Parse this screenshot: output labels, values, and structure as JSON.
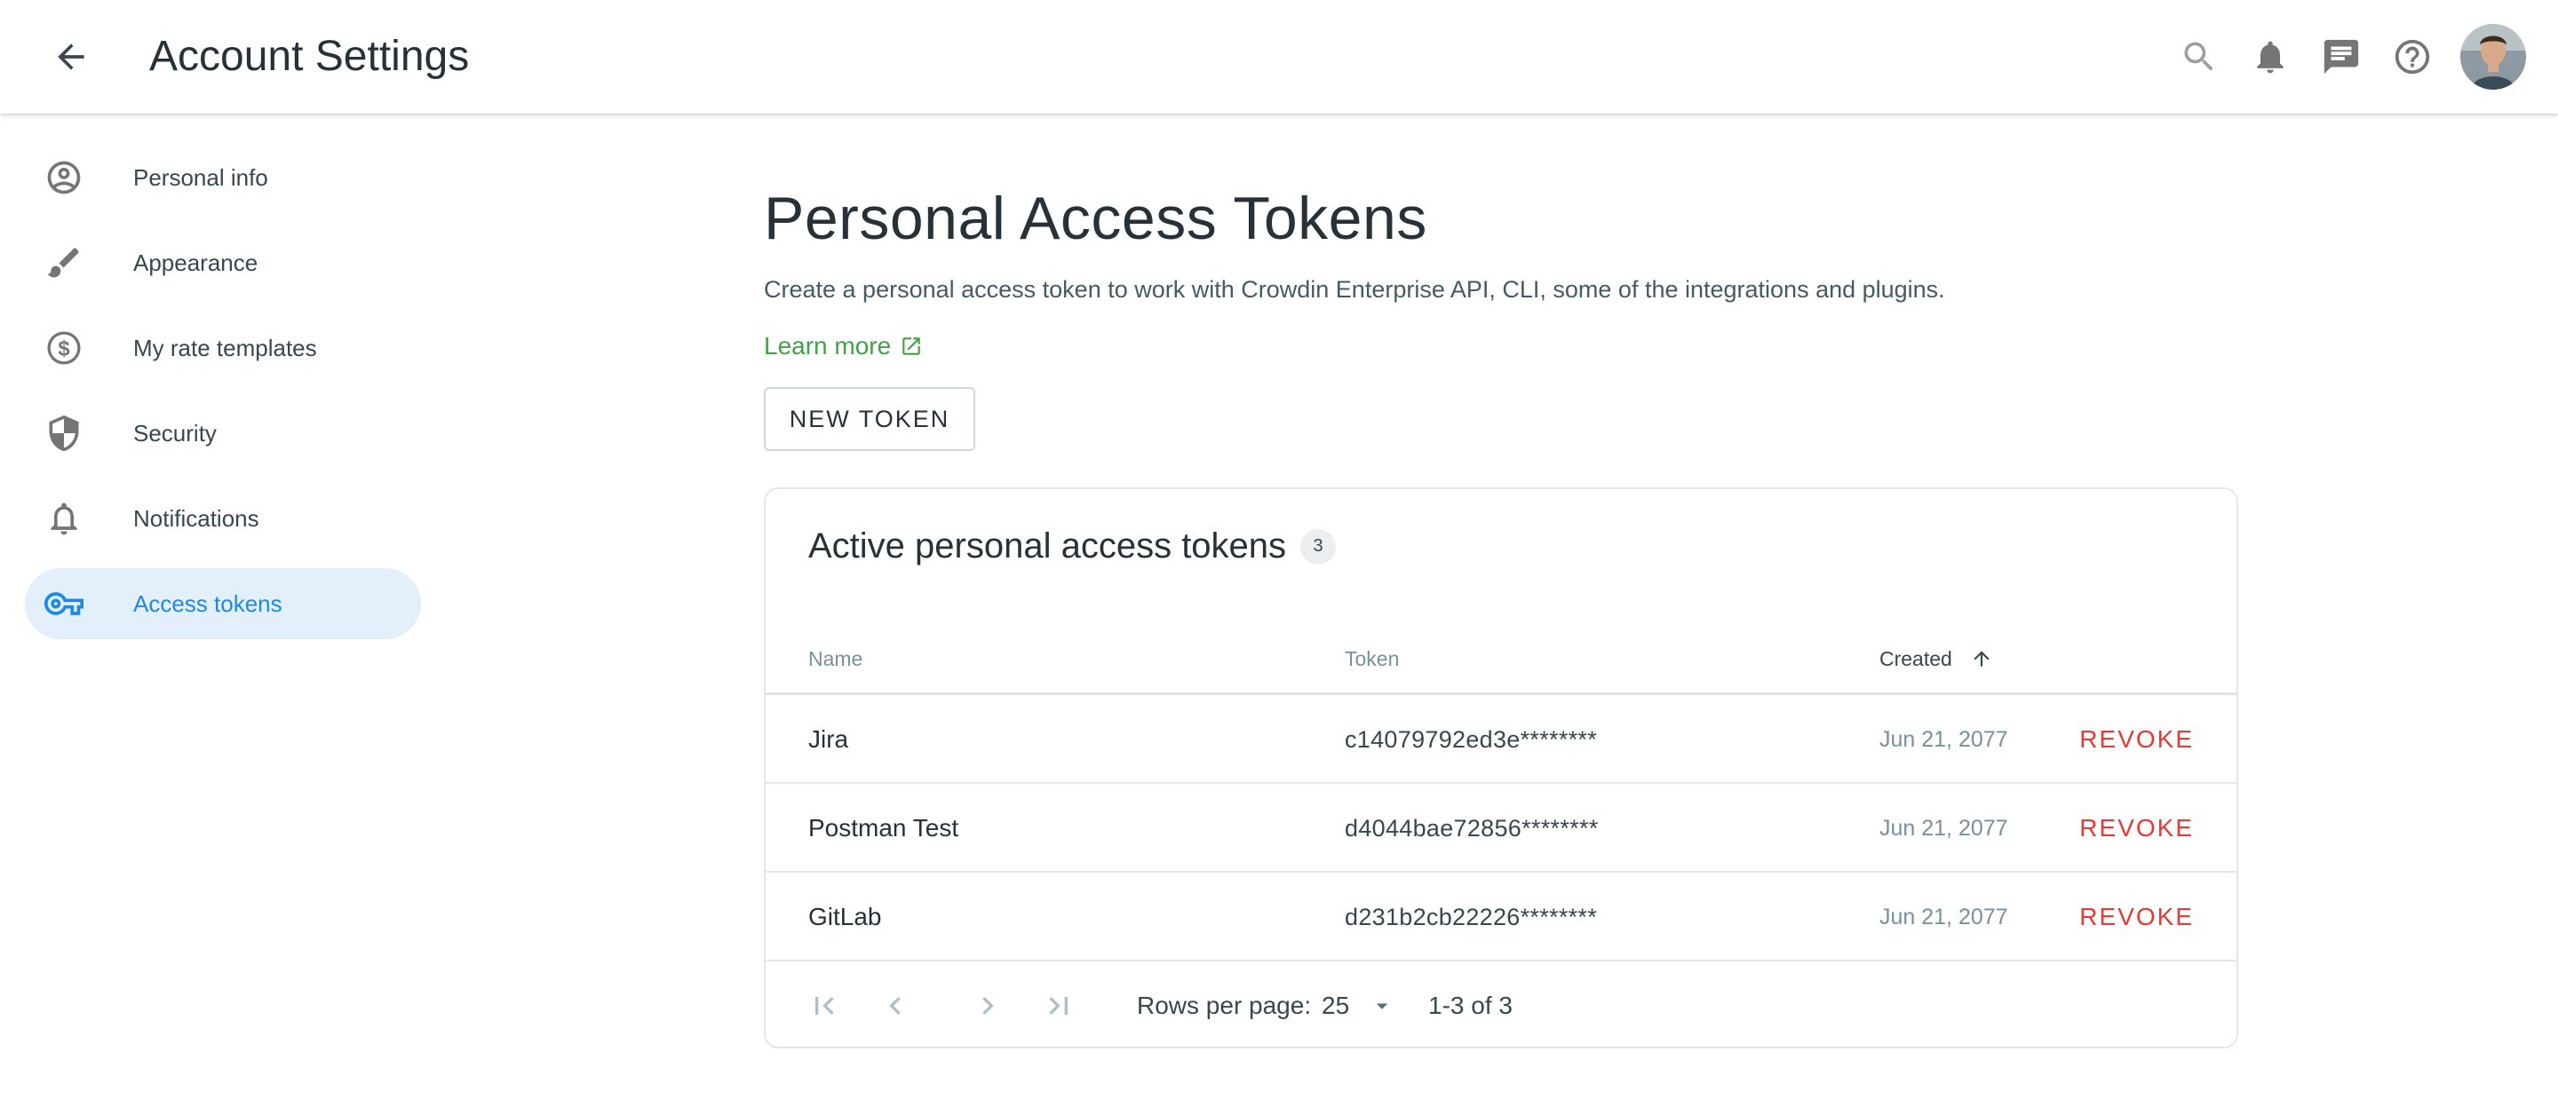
{
  "header": {
    "title": "Account Settings",
    "icons": [
      "arrow-back-icon",
      "search-icon",
      "bell-icon",
      "chat-icon",
      "help-icon"
    ]
  },
  "sidebar": {
    "items": [
      {
        "label": "Personal info",
        "icon": "account-circle-icon"
      },
      {
        "label": "Appearance",
        "icon": "brush-icon"
      },
      {
        "label": "My rate templates",
        "icon": "dollar-circle-icon"
      },
      {
        "label": "Security",
        "icon": "shield-icon"
      },
      {
        "label": "Notifications",
        "icon": "bell-outline-icon"
      },
      {
        "label": "Access tokens",
        "icon": "key-icon",
        "active": true
      }
    ]
  },
  "main": {
    "title": "Personal Access Tokens",
    "description": "Create a personal access token to work with Crowdin Enterprise API, CLI, some of the integrations and plugins.",
    "learn_more": "Learn more",
    "new_token_label": "NEW TOKEN"
  },
  "tokens": {
    "title": "Active personal access tokens",
    "count": "3",
    "columns": {
      "name": "Name",
      "token": "Token",
      "created": "Created"
    },
    "rows": [
      {
        "name": "Jira",
        "token": "c14079792ed3e********",
        "created": "Jun 21, 2077",
        "action": "REVOKE"
      },
      {
        "name": "Postman Test",
        "token": "d4044bae72856********",
        "created": "Jun 21, 2077",
        "action": "REVOKE"
      },
      {
        "name": "GitLab",
        "token": "d231b2cb22226********",
        "created": "Jun 21, 2077",
        "action": "REVOKE"
      }
    ],
    "pagination": {
      "rows_per_page_label": "Rows per page:",
      "rows_per_page": "25",
      "range": "1-3 of 3"
    }
  },
  "colors": {
    "accent": "#1e88e5",
    "active_bg": "#e3f0fc",
    "link": "#43a047",
    "danger": "#e53935",
    "text": "#263238"
  }
}
